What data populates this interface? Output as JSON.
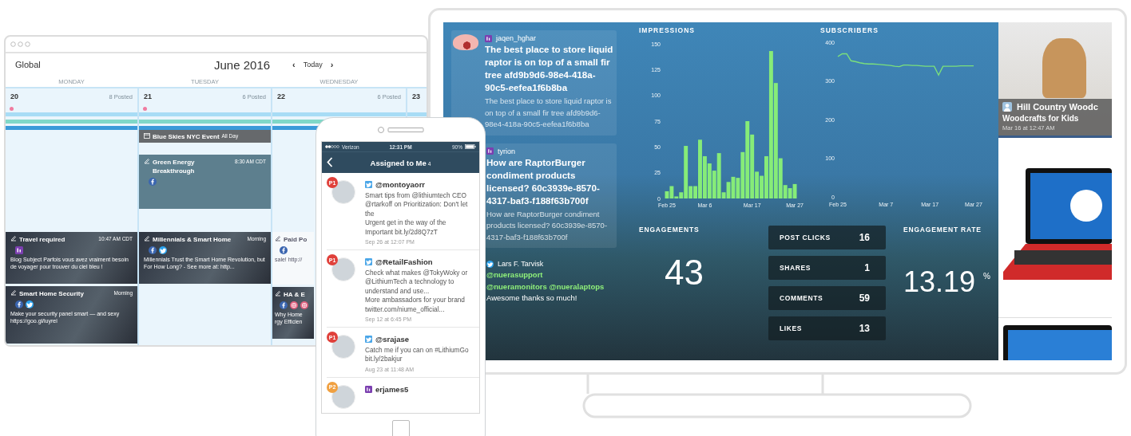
{
  "calendar": {
    "scope": "Global",
    "month": "June 2016",
    "prev": "‹",
    "today": "Today",
    "next": "›",
    "weekdays": [
      "MONDAY",
      "TUESDAY",
      "WEDNESDAY"
    ],
    "days": [
      {
        "date": "20",
        "posted": "8 Posted",
        "flagged": true,
        "events": [
          {
            "kind": "photo",
            "title": "Travel required",
            "time": "10:47 AM CDT",
            "body": "Blog Subject Parfois vous avez vraiment besoin de voyager pour trouver du ciel bleu !",
            "networks": [
              {
                "kind": "li"
              }
            ]
          },
          {
            "kind": "photo",
            "title": "Smart Home Security",
            "time": "Morning",
            "body": "Make your security panel smart — and sexy https://goo.gl/iuyrei",
            "networks": [
              {
                "kind": "facebook"
              },
              {
                "kind": "twitter"
              }
            ]
          }
        ]
      },
      {
        "date": "21",
        "posted": "6 Posted",
        "flagged": true,
        "events": [
          {
            "kind": "allday",
            "title": "Blue Skies NYC Event",
            "time": "All Day"
          },
          {
            "kind": "timed",
            "title": "Green Energy Breakthrough",
            "time": "8:30 AM CDT",
            "networks": [
              {
                "kind": "facebook"
              }
            ]
          },
          {
            "kind": "photo",
            "title": "Millennials & Smart Home",
            "time": "Morning",
            "body": "Millennials Trust the Smart Home Revolution, but For How Long? - See more at: http...",
            "networks": [
              {
                "kind": "facebook"
              },
              {
                "kind": "twitter"
              }
            ]
          }
        ]
      },
      {
        "date": "22",
        "posted": "6 Posted",
        "flagged": false,
        "events": [
          {
            "kind": "plain",
            "title": "Paid Po",
            "body": "sale! http://",
            "networks": [
              {
                "kind": "facebook"
              }
            ]
          },
          {
            "kind": "photo",
            "title": "HA & E",
            "body": "Why Home\nrgy Efficien",
            "networks": [
              {
                "kind": "facebook"
              },
              {
                "kind": "instagram"
              },
              {
                "kind": "instagram"
              }
            ]
          }
        ]
      },
      {
        "date": "23",
        "flagged": false
      }
    ]
  },
  "phone": {
    "carrier": "Verizon",
    "time": "12:31 PM",
    "battery": "90%",
    "title": "Assigned to Me",
    "count": "4",
    "items": [
      {
        "priority": "P1",
        "color": "#e0403a",
        "source": {
          "kind": "twitter"
        },
        "handle": "@montoyaorr",
        "text": "Smart tips from @lithiumtech CEO @rtarkoff on Prioritization: Don't let the\nUrgent get in the way of the Important bit.ly/2d8Q7zT",
        "time": "Sep 26 at 12:07 PM"
      },
      {
        "priority": "P1",
        "color": "#e0403a",
        "source": {
          "kind": "twitter"
        },
        "handle": "@RetailFashion",
        "text": "Check what makes @TokyWoky or @LithiumTech a technology to understand and use...\nMore ambassadors for your brand twitter.com/niume_official...",
        "time": "Sep 12 at 6:45 PM"
      },
      {
        "priority": "P1",
        "color": "#e0403a",
        "source": {
          "kind": "twitter"
        },
        "handle": "@srajase",
        "text": "Catch me if you can on #LithiumGo bit.ly/2bakjur",
        "time": "Aug 23 at 11:48 AM"
      },
      {
        "priority": "P2",
        "color": "#f0a040",
        "source": {
          "kind": "li"
        },
        "handle": "erjames5"
      }
    ]
  },
  "dashboard": {
    "posts": [
      {
        "source": {
          "kind": "li"
        },
        "avatar": true,
        "author": "jaqen_hghar",
        "title": "The best place to store liquid raptor is on top of a small fir tree afd9b9d6-98e4-418a-90c5-eefea1f6b8ba",
        "body": "The best place to store liquid raptor is on top of a small fir tree afd9b9d6-98e4-418a-90c5-eefea1f6b8ba"
      },
      {
        "source": {
          "kind": "li"
        },
        "avatar": false,
        "author": "tyrion",
        "title": "How are RaptorBurger condiment products licensed? 60c3939e-8570-4317-baf3-f188f63b700f",
        "body": "How are RaptorBurger condiment products licensed? 60c3939e-8570-4317-baf3-f188f63b700f"
      },
      {
        "source": {
          "kind": "twitter"
        },
        "avatar": false,
        "author": "Lars F. Tarvisk",
        "segments": [
          {
            "kind": "mention",
            "text": "@nuerasupport"
          },
          {
            "kind": "mention",
            "text": "@nueramonitors"
          },
          {
            "kind": "mention",
            "text": "@nueralaptops"
          },
          {
            "kind": "plain",
            "text": "Awesome thanks so much!"
          }
        ]
      }
    ],
    "impressions": {
      "chart_data": {
        "type": "bar",
        "title": "IMPRESSIONS",
        "categories": [
          "Feb 25",
          null,
          null,
          null,
          null,
          null,
          null,
          null,
          "Mar 6",
          null,
          null,
          null,
          null,
          null,
          null,
          null,
          null,
          null,
          "Mar 17",
          null,
          null,
          null,
          null,
          null,
          null,
          null,
          null,
          "Mar 27"
        ],
        "values": [
          7,
          12,
          2,
          6,
          51,
          12,
          12,
          57,
          41,
          34,
          27,
          44,
          6,
          16,
          21,
          20,
          45,
          75,
          62,
          26,
          22,
          41,
          143,
          112,
          39,
          13,
          10,
          14
        ],
        "ylim": [
          0,
          150
        ],
        "yticks": [
          0,
          25,
          50,
          75,
          100,
          125,
          150
        ]
      }
    },
    "subscribers": {
      "chart_data": {
        "type": "line",
        "title": "SUBSCRIBERS",
        "categories": [
          "Feb 25",
          null,
          null,
          null,
          null,
          null,
          null,
          null,
          null,
          null,
          null,
          "Mar 7",
          null,
          null,
          null,
          null,
          null,
          null,
          null,
          null,
          null,
          "Mar 17",
          null,
          null,
          null,
          null,
          null,
          null,
          null,
          null,
          null,
          "Mar 27"
        ],
        "series": [
          {
            "color": "#7be07b",
            "values": [
              363,
              370,
              370,
              352,
              350,
              347,
              345,
              344,
              344,
              343,
              342,
              341,
              340,
              338,
              337,
              341,
              341,
              340,
              340,
              339,
              338,
              338,
              338,
              315,
              338,
              338,
              338,
              338,
              339,
              339,
              339,
              339
            ]
          }
        ],
        "ylim": [
          0,
          400
        ],
        "yticks": [
          0,
          100,
          200,
          300,
          400
        ]
      }
    },
    "engagements": {
      "label": "ENGAGEMENTS",
      "value": "43"
    },
    "breakdown": [
      {
        "label": "POST CLICKS",
        "value": "16"
      },
      {
        "label": "SHARES",
        "value": "1"
      },
      {
        "label": "COMMENTS",
        "value": "59"
      },
      {
        "label": "LIKES",
        "value": "13"
      }
    ],
    "engagement_rate": {
      "label": "ENGAGEMENT RATE",
      "value": "13.19",
      "unit": "%"
    },
    "products": [
      {
        "kind": "post",
        "author": "Hill Country Woodc",
        "title": "Woodcrafts for Kids",
        "time": "Mar 16 at 12:47 AM"
      },
      {
        "kind": "photo"
      },
      {
        "kind": "photo"
      }
    ]
  }
}
